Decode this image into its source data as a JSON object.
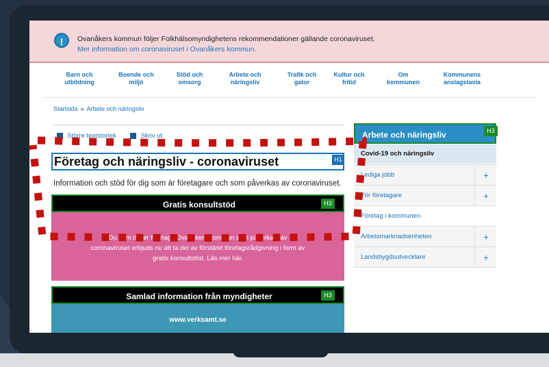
{
  "alert": {
    "text": "Ovanåkers kommun följer Folkhälsomyndighetens rekommendationer gällande coronaviruset.",
    "link": "Mer information om coronaviruset i Ovanåkers kommun.",
    "icon": "warning-icon"
  },
  "nav": [
    {
      "l1": "Barn och",
      "l2": "utbildning"
    },
    {
      "l1": "Boende och",
      "l2": "miljö"
    },
    {
      "l1": "Stöd och",
      "l2": "omsorg"
    },
    {
      "l1": "Arbete och",
      "l2": "näringsliv"
    },
    {
      "l1": "Trafik och",
      "l2": "gator"
    },
    {
      "l1": "Kultur och",
      "l2": "fritid"
    },
    {
      "l1": "Om",
      "l2": "kommunen"
    },
    {
      "l1": "Kommunens",
      "l2": "anslagstavla"
    }
  ],
  "breadcrumb": {
    "home": "Startsida",
    "sep": "»",
    "current": "Arbete och näringsliv"
  },
  "tools": {
    "text_size": "Större textstorlek",
    "print": "Skriv ut"
  },
  "page": {
    "title": "Företag och näringsliv - coronaviruset",
    "h1_badge": "H1",
    "lead": "Information och stöd för dig som är företagare och som påverkas av coronaviruset."
  },
  "cards": [
    {
      "title": "Gratis konsultstöd",
      "badge": "H3",
      "body_l1": "Du som driver företag i Ovanåkers kommun som påverkats av",
      "body_l2": "coronaviruset erbjuds nu att ta del av förstärkt företagsrådgivning i form av",
      "body_l3": "gratis konsultstöd. Läs mer här.",
      "color": "#d9649a"
    },
    {
      "title": "Samlad information från myndigheter",
      "badge": "H3",
      "link": "www.verksamt.se",
      "color": "#3e97b5"
    }
  ],
  "sidebar": {
    "title": "Arbete och näringsliv",
    "badge": "H3",
    "active": "Covid-19 och näringsliv",
    "items": [
      "Lediga jobb",
      "För företagare",
      "Företag i kommunen",
      "Arbetsmarknadsenheten",
      "Landsbygdsutvecklare"
    ],
    "plus": "+"
  },
  "colors": {
    "accent": "#1a73b8",
    "h3": "#1b8a2a",
    "alert_bg": "#f5d7da",
    "dots": "#c4120f"
  }
}
